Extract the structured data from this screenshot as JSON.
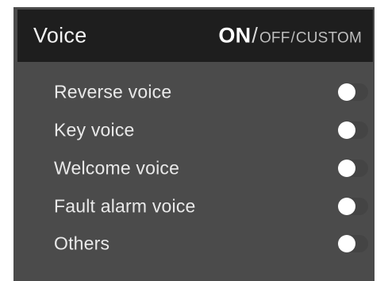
{
  "header": {
    "title": "Voice",
    "mode_on": "ON",
    "mode_separator": "/",
    "mode_off": "OFF",
    "mode_separator2": "/",
    "mode_custom": "CUSTOM"
  },
  "settings": {
    "items": [
      {
        "label": "Reverse voice",
        "toggle_icon": "toggle-switch-icon"
      },
      {
        "label": "Key voice",
        "toggle_icon": "toggle-switch-icon"
      },
      {
        "label": "Welcome voice",
        "toggle_icon": "toggle-switch-icon"
      },
      {
        "label": "Fault alarm voice",
        "toggle_icon": "toggle-switch-icon"
      },
      {
        "label": "Others",
        "toggle_icon": "toggle-switch-icon"
      }
    ]
  },
  "colors": {
    "panel_bg": "#4b4b4b",
    "header_bg": "#1e1e1e",
    "text": "#e9e9e9",
    "knob": "#ffffff"
  }
}
